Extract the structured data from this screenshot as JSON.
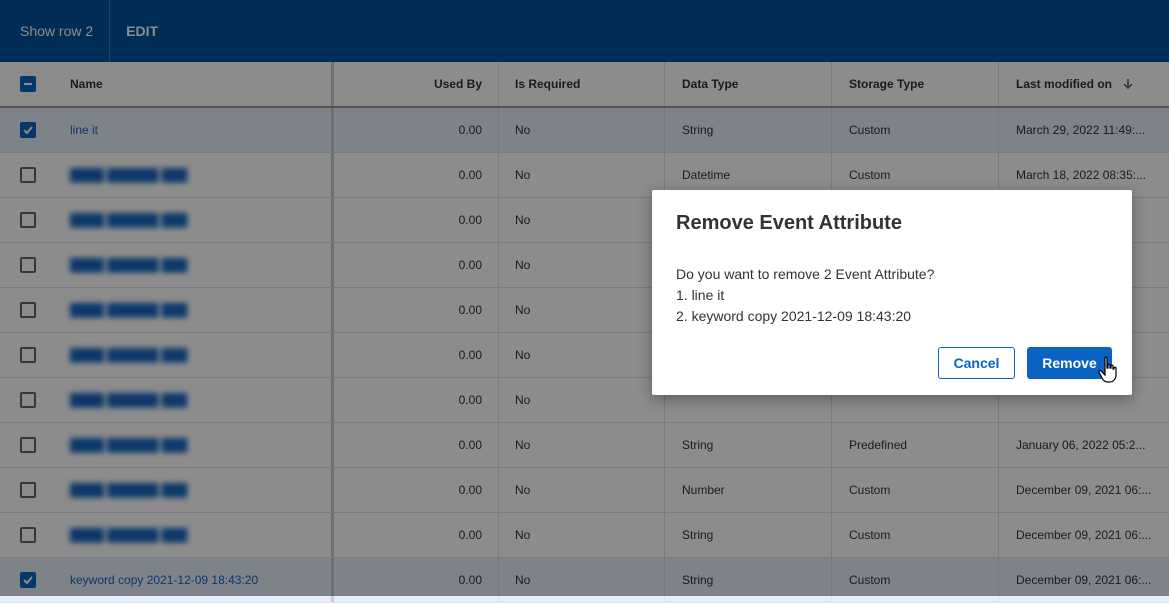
{
  "topbar": {
    "show_row": "Show row 2",
    "edit": "EDIT"
  },
  "table": {
    "columns": {
      "name": "Name",
      "used_by": "Used By",
      "is_required": "Is Required",
      "data_type": "Data Type",
      "storage_type": "Storage Type",
      "last_modified": "Last modified on"
    },
    "rows": [
      {
        "name": "line it",
        "used_by": "0.00",
        "is_required": "No",
        "data_type": "String",
        "storage_type": "Custom",
        "last_modified": "March 29, 2022 11:49:...",
        "selected": true,
        "blurred": false
      },
      {
        "name": "",
        "used_by": "0.00",
        "is_required": "No",
        "data_type": "Datetime",
        "storage_type": "Custom",
        "last_modified": "March 18, 2022 08:35:...",
        "selected": false,
        "blurred": true
      },
      {
        "name": "",
        "used_by": "0.00",
        "is_required": "No",
        "data_type": "",
        "storage_type": "",
        "last_modified": "",
        "selected": false,
        "blurred": true
      },
      {
        "name": "",
        "used_by": "0.00",
        "is_required": "No",
        "data_type": "",
        "storage_type": "",
        "last_modified": "",
        "selected": false,
        "blurred": true
      },
      {
        "name": "",
        "used_by": "0.00",
        "is_required": "No",
        "data_type": "",
        "storage_type": "",
        "last_modified": "",
        "selected": false,
        "blurred": true
      },
      {
        "name": "",
        "used_by": "0.00",
        "is_required": "No",
        "data_type": "",
        "storage_type": "",
        "last_modified": "",
        "selected": false,
        "blurred": true
      },
      {
        "name": "",
        "used_by": "0.00",
        "is_required": "No",
        "data_type": "",
        "storage_type": "",
        "last_modified": "",
        "selected": false,
        "blurred": true
      },
      {
        "name": "",
        "used_by": "0.00",
        "is_required": "No",
        "data_type": "String",
        "storage_type": "Predefined",
        "last_modified": "January 06, 2022 05:2...",
        "selected": false,
        "blurred": true
      },
      {
        "name": "",
        "used_by": "0.00",
        "is_required": "No",
        "data_type": "Number",
        "storage_type": "Custom",
        "last_modified": "December 09, 2021 06:...",
        "selected": false,
        "blurred": true
      },
      {
        "name": "",
        "used_by": "0.00",
        "is_required": "No",
        "data_type": "String",
        "storage_type": "Custom",
        "last_modified": "December 09, 2021 06:...",
        "selected": false,
        "blurred": true
      },
      {
        "name": "keyword copy 2021-12-09 18:43:20",
        "used_by": "0.00",
        "is_required": "No",
        "data_type": "String",
        "storage_type": "Custom",
        "last_modified": "December 09, 2021 06:...",
        "selected": true,
        "blurred": false
      }
    ]
  },
  "dialog": {
    "title": "Remove Event Attribute",
    "question": "Do you want to remove 2 Event Attribute?",
    "items": [
      "1. line it",
      "2. keyword copy 2021-12-09 18:43:20"
    ],
    "cancel_label": "Cancel",
    "remove_label": "Remove"
  },
  "colors": {
    "topbar": "#00539b",
    "accent": "#0b63c1",
    "selected_row": "#e3eef9"
  },
  "icons": {
    "sort": "arrow-down-icon",
    "cursor": "hand-pointer-icon"
  }
}
